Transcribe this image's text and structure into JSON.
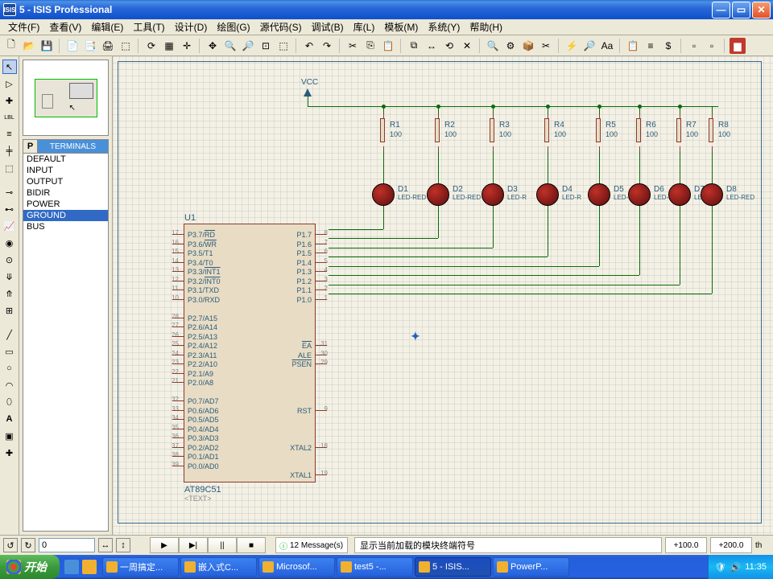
{
  "title": "5 - ISIS Professional",
  "app_icon": "ISIS",
  "menu": [
    "文件(F)",
    "查看(V)",
    "编辑(E)",
    "工具(T)",
    "设计(D)",
    "绘图(G)",
    "源代码(S)",
    "调试(B)",
    "库(L)",
    "模板(M)",
    "系统(Y)",
    "帮助(H)"
  ],
  "picklist": {
    "header": "TERMINALS",
    "p_button": "P",
    "items": [
      "DEFAULT",
      "INPUT",
      "OUTPUT",
      "BIDIR",
      "POWER",
      "GROUND",
      "BUS"
    ],
    "selected": 5
  },
  "vcc_label": "VCC",
  "chip": {
    "ref": "U1",
    "part": "AT89C51",
    "txt": "<TEXT>",
    "left_pins": [
      {
        "n": "17",
        "t": "P3.7/RD",
        "ov": true
      },
      {
        "n": "16",
        "t": "P3.6/WR",
        "ov": true
      },
      {
        "n": "15",
        "t": "P3.5/T1"
      },
      {
        "n": "14",
        "t": "P3.4/T0"
      },
      {
        "n": "13",
        "t": "P3.3/INT1",
        "ov": true
      },
      {
        "n": "12",
        "t": "P3.2/INT0",
        "ov": true
      },
      {
        "n": "11",
        "t": "P3.1/TXD"
      },
      {
        "n": "10",
        "t": "P3.0/RXD"
      },
      {
        "n": "",
        "t": ""
      },
      {
        "n": "28",
        "t": "P2.7/A15"
      },
      {
        "n": "27",
        "t": "P2.6/A14"
      },
      {
        "n": "26",
        "t": "P2.5/A13"
      },
      {
        "n": "25",
        "t": "P2.4/A12"
      },
      {
        "n": "24",
        "t": "P2.3/A11"
      },
      {
        "n": "23",
        "t": "P2.2/A10"
      },
      {
        "n": "22",
        "t": "P2.1/A9"
      },
      {
        "n": "21",
        "t": "P2.0/A8"
      },
      {
        "n": "",
        "t": ""
      },
      {
        "n": "32",
        "t": "P0.7/AD7"
      },
      {
        "n": "33",
        "t": "P0.6/AD6"
      },
      {
        "n": "34",
        "t": "P0.5/AD5"
      },
      {
        "n": "35",
        "t": "P0.4/AD4"
      },
      {
        "n": "36",
        "t": "P0.3/AD3"
      },
      {
        "n": "37",
        "t": "P0.2/AD2"
      },
      {
        "n": "38",
        "t": "P0.1/AD1"
      },
      {
        "n": "39",
        "t": "P0.0/AD0"
      }
    ],
    "right_pins": [
      {
        "n": "8",
        "t": "P1.7"
      },
      {
        "n": "7",
        "t": "P1.6"
      },
      {
        "n": "6",
        "t": "P1.5"
      },
      {
        "n": "5",
        "t": "P1.4"
      },
      {
        "n": "4",
        "t": "P1.3"
      },
      {
        "n": "3",
        "t": "P1.2"
      },
      {
        "n": "2",
        "t": "P1.1"
      },
      {
        "n": "1",
        "t": "P1.0"
      },
      {
        "n": "",
        "t": ""
      },
      {
        "n": "",
        "t": ""
      },
      {
        "n": "",
        "t": ""
      },
      {
        "n": "",
        "t": ""
      },
      {
        "n": "31",
        "t": "EA",
        "ov": true
      },
      {
        "n": "30",
        "t": "ALE"
      },
      {
        "n": "29",
        "t": "PSEN",
        "ov": true
      },
      {
        "n": "",
        "t": ""
      },
      {
        "n": "",
        "t": ""
      },
      {
        "n": "",
        "t": ""
      },
      {
        "n": "",
        "t": ""
      },
      {
        "n": "9",
        "t": "RST"
      },
      {
        "n": "",
        "t": ""
      },
      {
        "n": "",
        "t": ""
      },
      {
        "n": "",
        "t": ""
      },
      {
        "n": "18",
        "t": "XTAL2"
      },
      {
        "n": "",
        "t": ""
      },
      {
        "n": "",
        "t": ""
      },
      {
        "n": "19",
        "t": "XTAL1"
      }
    ]
  },
  "resistors": [
    {
      "ref": "R1",
      "val": "100"
    },
    {
      "ref": "R2",
      "val": "100"
    },
    {
      "ref": "R3",
      "val": "100"
    },
    {
      "ref": "R4",
      "val": "100"
    },
    {
      "ref": "R5",
      "val": "100"
    },
    {
      "ref": "R6",
      "val": "100"
    },
    {
      "ref": "R7",
      "val": "100"
    },
    {
      "ref": "R8",
      "val": "100"
    }
  ],
  "leds": [
    {
      "ref": "D1",
      "val": "LED-RED"
    },
    {
      "ref": "D2",
      "val": "LED-RED"
    },
    {
      "ref": "D3",
      "val": "LED-R"
    },
    {
      "ref": "D4",
      "val": "LED-R"
    },
    {
      "ref": "D5",
      "val": "LED-R"
    },
    {
      "ref": "D6",
      "val": "LED-R"
    },
    {
      "ref": "D7",
      "val": "LED-R"
    },
    {
      "ref": "D8",
      "val": "LED-RED"
    }
  ],
  "placeholder_txt": "<TEXT>",
  "bottom": {
    "rot": "0",
    "messages": "12 Message(s)",
    "status": "显示当前加载的模块终端符号",
    "coord_x": "+100.0",
    "coord_y": "+200.0",
    "unit": "th"
  },
  "taskbar": {
    "start": "开始",
    "tasks": [
      "一周搞定...",
      "嵌入式C...",
      "Microsof...",
      "test5  -...",
      "5 - ISIS...",
      "PowerP..."
    ],
    "activeTask": 4,
    "time": "11:35"
  }
}
